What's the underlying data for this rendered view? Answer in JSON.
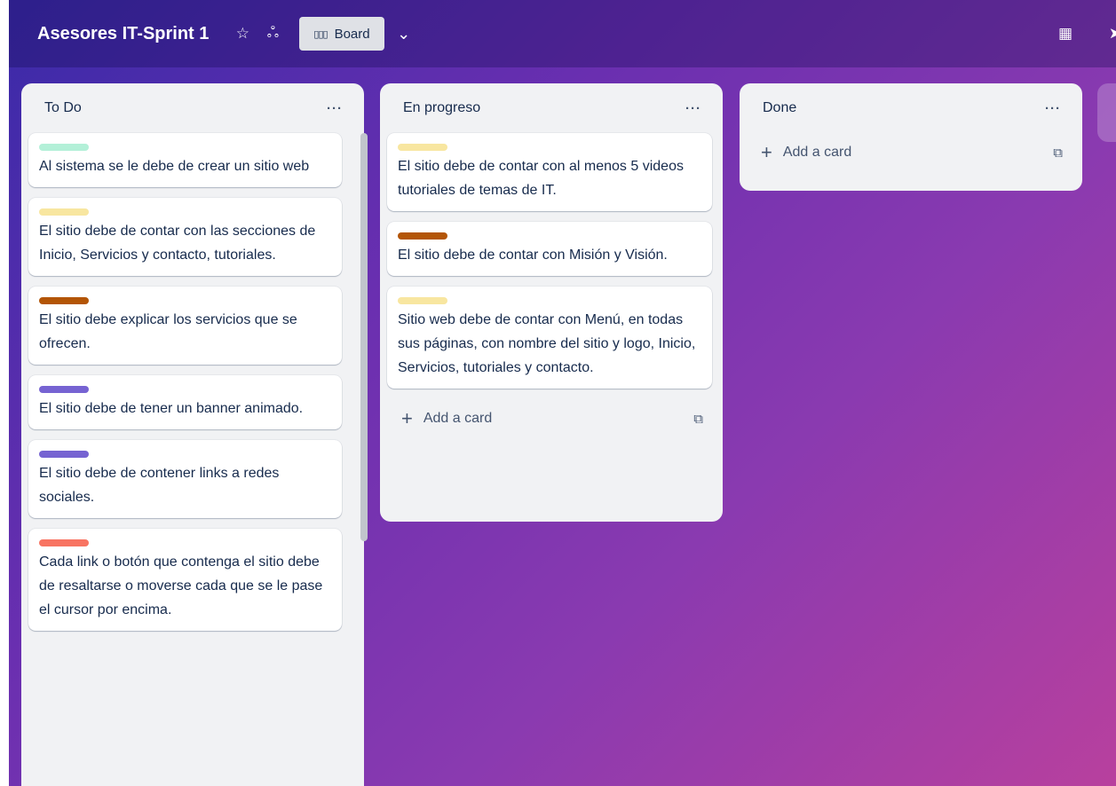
{
  "header": {
    "board_title": "Asesores IT-Sprint 1",
    "star_icon": "☆",
    "visibility_icon": "ஃ",
    "view_icon": "▯▯▯",
    "view_label": "Board",
    "chevron_icon": "⌄",
    "calendar_icon": "▦",
    "send_icon": "➤"
  },
  "lists": [
    {
      "title": "To Do",
      "menu": "···",
      "cards": [
        {
          "label_color": "#b3f0d8",
          "text": "Al sistema se le debe de crear un sitio web"
        },
        {
          "label_color": "#f8e6a0",
          "text": "El sitio debe de contar con las secciones de Inicio, Servicios y contacto, tutoriales."
        },
        {
          "label_color": "#b35506",
          "text": "El sitio debe explicar los servicios que se ofrecen."
        },
        {
          "label_color": "#7663d2",
          "text": "El sitio debe de tener un banner animado."
        },
        {
          "label_color": "#7663d2",
          "text": "El sitio debe de contener links a redes sociales."
        },
        {
          "label_color": "#f87462",
          "text": "Cada link o botón que contenga el sitio debe de resaltarse o moverse cada que se le pase el cursor por encima."
        }
      ]
    },
    {
      "title": "En progreso",
      "menu": "···",
      "cards": [
        {
          "label_color": "#f8e6a0",
          "text": "El sitio debe de contar con al menos 5 videos tutoriales de temas de IT."
        },
        {
          "label_color": "#b35506",
          "text": "El sitio debe de contar con Misión y Visión."
        },
        {
          "label_color": "#f8e6a0",
          "text": "Sitio web debe de contar con Menú, en todas sus páginas, con nombre del sitio y logo, Inicio, Servicios, tutoriales y contacto."
        }
      ],
      "add_card": "Add a card"
    },
    {
      "title": "Done",
      "menu": "···",
      "cards": [],
      "add_card": "Add a card"
    }
  ],
  "icons": {
    "plus": "+",
    "template": "⧉"
  }
}
